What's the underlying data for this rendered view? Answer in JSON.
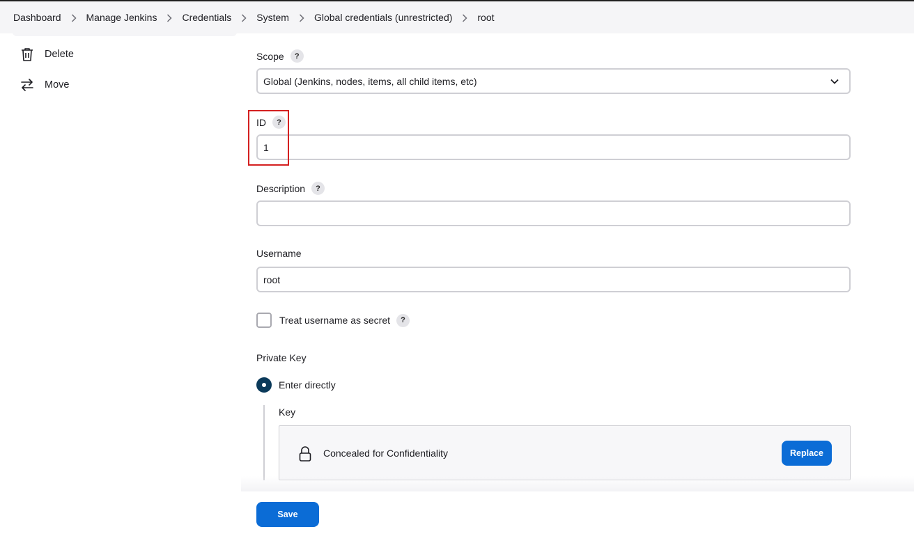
{
  "breadcrumb": {
    "items": [
      "Dashboard",
      "Manage Jenkins",
      "Credentials",
      "System",
      "Global credentials (unrestricted)",
      "root"
    ]
  },
  "sidebar": {
    "items": [
      {
        "label": "Delete",
        "icon": "trash-icon"
      },
      {
        "label": "Move",
        "icon": "arrows-swap-icon"
      }
    ]
  },
  "form": {
    "scope": {
      "label": "Scope",
      "help": "?",
      "value": "Global (Jenkins, nodes, items, all child items, etc)"
    },
    "id": {
      "label": "ID",
      "help": "?",
      "value": "1"
    },
    "description": {
      "label": "Description",
      "help": "?",
      "value": ""
    },
    "username": {
      "label": "Username",
      "value": "root"
    },
    "treat_secret": {
      "label": "Treat username as secret",
      "help": "?",
      "checked": false
    },
    "private_key": {
      "label": "Private Key",
      "option": "Enter directly",
      "key_label": "Key",
      "concealed_text": "Concealed for Confidentiality",
      "replace_label": "Replace"
    }
  },
  "actions": {
    "save_label": "Save"
  },
  "colors": {
    "primary": "#0b6cd6",
    "radio": "#0b3a5a",
    "highlight": "#d42020"
  }
}
